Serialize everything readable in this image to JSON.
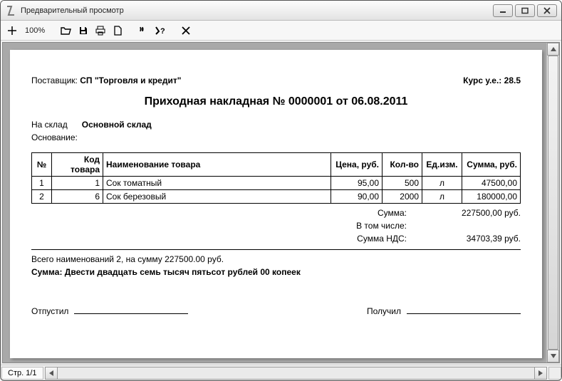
{
  "window": {
    "title": "Предварительный просмотр"
  },
  "toolbar": {
    "zoom": "100%"
  },
  "doc": {
    "supplier_label": "Поставщик:",
    "supplier_value": "СП \"Торговля и кредит\"",
    "rate_label": "Курс у.е.: 28.5",
    "title": "Приходная накладная № 0000001 от 06.08.2011",
    "warehouse_label": "На склад",
    "warehouse_value": "Основной склад",
    "basis_label": "Основание:",
    "columns": {
      "num": "№",
      "code": "Код товара",
      "name": "Наименование товара",
      "price": "Цена, руб.",
      "qty": "Кол-во",
      "unit": "Ед.изм.",
      "sum": "Сумма, руб."
    },
    "rows": [
      {
        "num": "1",
        "code": "1",
        "name": "Сок томатный",
        "price": "95,00",
        "qty": "500",
        "unit": "л",
        "sum": "47500,00"
      },
      {
        "num": "2",
        "code": "6",
        "name": "Сок березовый",
        "price": "90,00",
        "qty": "2000",
        "unit": "л",
        "sum": "180000,00"
      }
    ],
    "totals": {
      "sum_label": "Сумма:",
      "sum_value": "227500,00 руб.",
      "incl_label": "В том числе:",
      "vat_label": "Сумма НДС:",
      "vat_value": "34703,39 руб."
    },
    "summary1": "Всего наименований 2, на сумму 227500.00 руб.",
    "summary2_label": "Сумма:",
    "summary2_value": "Двести двадцать семь тысяч пятьсот рублей 00 копеек",
    "sign_released": "Отпустил",
    "sign_received": "Получил"
  },
  "status": {
    "page": "Стр. 1/1"
  }
}
